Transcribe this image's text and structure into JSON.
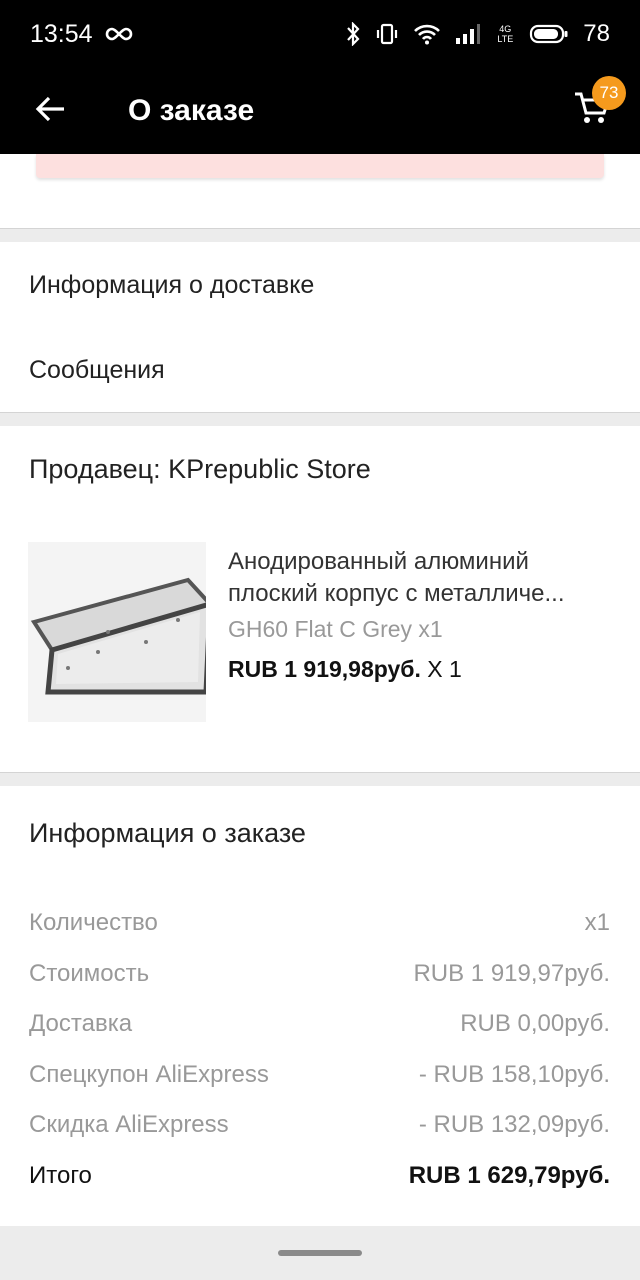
{
  "status_bar": {
    "time": "13:54",
    "battery": "78",
    "net_label": "4G LTE",
    "icons": [
      "infinity-icon",
      "bluetooth-icon",
      "vibrate-icon",
      "wifi-icon",
      "signal-icon",
      "battery-icon"
    ]
  },
  "app_bar": {
    "title": "О заказе",
    "cart_count": "73"
  },
  "links": {
    "delivery_info": "Информация о доставке",
    "messages": "Сообщения"
  },
  "seller": {
    "title": "Продавец: KPrepublic Store",
    "product": {
      "name_line1": "Анодированный алюминий",
      "name_line2": "плоский корпус с металличе...",
      "sku": "GH60 Flat C Grey x1",
      "price": "RUB 1 919,98руб.",
      "qty": " X 1"
    }
  },
  "order_info": {
    "title": "Информация о заказе",
    "rows": [
      {
        "label": "Количество",
        "value": "x1"
      },
      {
        "label": "Стоимость",
        "value": "RUB 1 919,97руб."
      },
      {
        "label": "Доставка",
        "value": "RUB 0,00руб."
      },
      {
        "label": "Спецкупон AliExpress",
        "value": "- RUB 158,10руб."
      },
      {
        "label": "Скидка AliExpress",
        "value": "- RUB 132,09руб."
      },
      {
        "label": "Итого",
        "value": "RUB 1 629,79руб."
      }
    ]
  },
  "colors": {
    "accent_badge": "#f59a1d",
    "alert_card": "#fde0df"
  }
}
